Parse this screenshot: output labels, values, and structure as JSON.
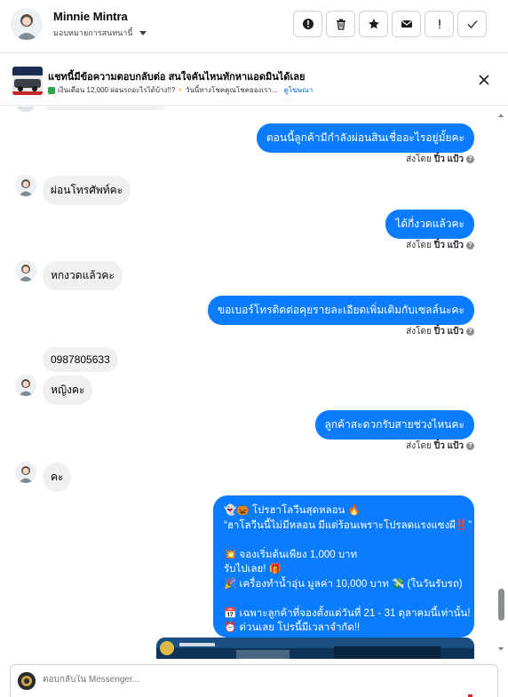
{
  "header": {
    "name": "Minnie Mintra",
    "subtitle": "มอบหมายการสนทนานี้",
    "actions": [
      "report-icon",
      "delete-icon",
      "star-icon",
      "mail-icon",
      "spam-icon",
      "done-icon"
    ]
  },
  "banner": {
    "title": "แชทนี้มีข้อความตอบกลับต่อ สนใจคันไหนทักหาแอดมินได้เลย",
    "line": "เงินเดือน 12,000 ผ่อนรถอะไรได้บ้าง!!?",
    "line2": "วันนี้ทางโชคคูณโชคยองเรา...",
    "link": "ดูโฆษณา"
  },
  "sent_by_prefix": "ส่งโดย",
  "sender_name": "ปิ๋ว แป้ว",
  "messages": {
    "m1": "ตอนนี้ลูกค้ามีกำลังผ่อนสินเชื่ออะไรอยู่มั้ยคะ",
    "m2": "ผ่อนโทรศัพท์คะ",
    "m3": "ได้กี่งวดแล้วคะ",
    "m4": "หกงวดแล้วคะ",
    "m5": "ขอเบอร์โทรติดต่อคุยรายละเอียดเพิ่มเติมกับเซลล์นะคะ",
    "m6a": "0987805633",
    "m6b": "หญิงคะ",
    "m7": "ลูกค้าสะดวกรับสายช่วงไหนคะ",
    "m8": "คะ"
  },
  "promo": {
    "l1": "👻🎃 โปรฮาโลวีนสุดหลอน 🔥",
    "l2": "“ฮาโลวีนนี้ไม่มีหลอน มีแต่ร้อนเพราะโปรลดแรงแซงผี‼️”",
    "l3": "💥 จองเริ่มต้นเพียง 1,000 บาท",
    "l4": "รับไปเลย! 🎁",
    "l5": "🎉 เครื่องทำน้ำอุ่น มูลค่า 10,000 บาท 💸 (ในวันรับรถ)",
    "l6": "📅 เฉพาะลูกค้าที่จองตั้งแต่วันที่ 21 - 31 ตุลาคมนี้เท่านั้น!",
    "l7": "⏰ ด่วนเลย โปรนี้มีเวลาจำกัด!!"
  },
  "composer": {
    "placeholder": "ตอบกลับใน Messenger..."
  },
  "colors": {
    "outgoing_bubble": "#0a7cff",
    "incoming_bubble": "#f0f0f0",
    "link": "#0a66c2"
  }
}
